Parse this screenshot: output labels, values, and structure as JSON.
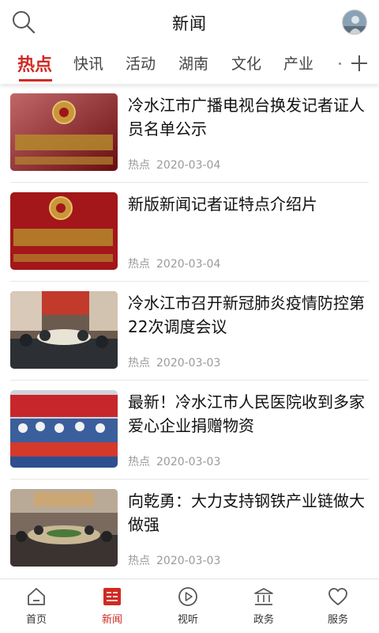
{
  "header": {
    "title": "新闻",
    "search_icon": "search-icon",
    "avatar_icon": "user-avatar"
  },
  "tabs": [
    {
      "label": "热点",
      "active": true
    },
    {
      "label": "快讯",
      "active": false
    },
    {
      "label": "活动",
      "active": false
    },
    {
      "label": "湖南",
      "active": false
    },
    {
      "label": "文化",
      "active": false
    },
    {
      "label": "产业",
      "active": false
    }
  ],
  "tabs_add_icon": "plus-icon",
  "accent_color": "#d02a22",
  "articles": [
    {
      "title": "冷水江市广播电视台换发记者证人员名单公示",
      "tag": "热点",
      "date": "2020-03-04",
      "thumb": "press-card-photo"
    },
    {
      "title": "新版新闻记者证特点介绍片",
      "tag": "热点",
      "date": "2020-03-04",
      "thumb": "press-card-photo"
    },
    {
      "title": "冷水江市召开新冠肺炎疫情防控第 22次调度会议",
      "tag": "热点",
      "date": "2020-03-03",
      "thumb": "meeting-photo"
    },
    {
      "title": "最新！冷水江市人民医院收到多家爱心企业捐赠物资",
      "tag": "热点",
      "date": "2020-03-03",
      "thumb": "donation-banner-photo"
    },
    {
      "title": "向乾勇：大力支持钢铁产业链做大做强",
      "tag": "热点",
      "date": "2020-03-03",
      "thumb": "meeting-room-photo"
    }
  ],
  "bottom_nav": [
    {
      "label": "首页",
      "icon": "home-icon",
      "active": false
    },
    {
      "label": "新闻",
      "icon": "news-icon",
      "active": true
    },
    {
      "label": "视听",
      "icon": "play-icon",
      "active": false
    },
    {
      "label": "政务",
      "icon": "government-icon",
      "active": false
    },
    {
      "label": "服务",
      "icon": "heart-icon",
      "active": false
    }
  ]
}
